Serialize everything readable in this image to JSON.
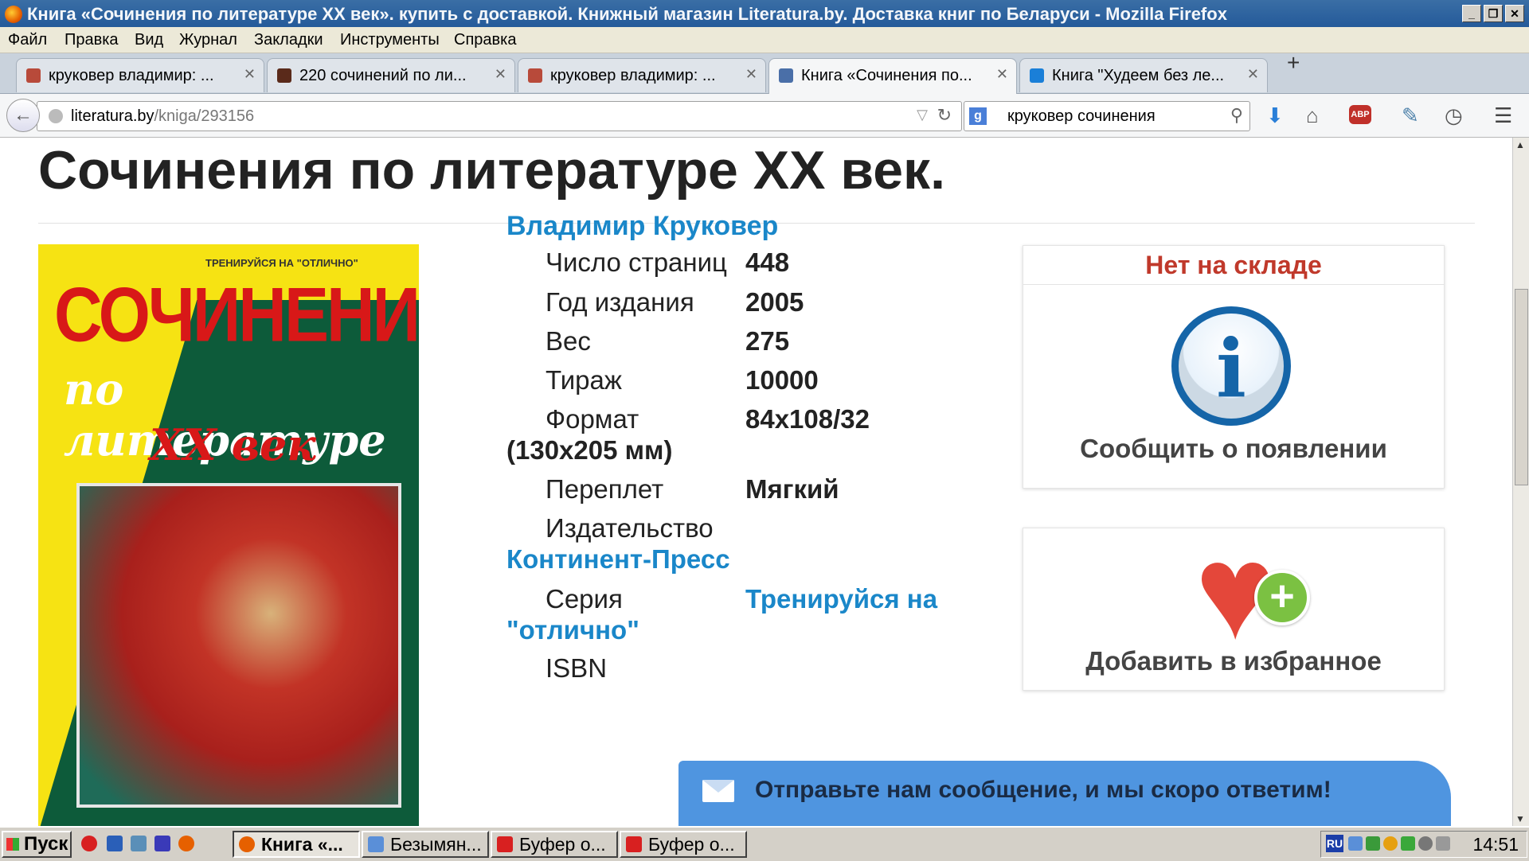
{
  "window": {
    "title": "Книга «Сочинения по литературе XX век». купить с доставкой. Книжный магазин Literatura.by. Доставка книг по Беларуси - Mozilla Firefox",
    "controls": [
      "_",
      "❐",
      "✕"
    ]
  },
  "menu": [
    "Файл",
    "Правка",
    "Вид",
    "Журнал",
    "Закладки",
    "Инструменты",
    "Справка"
  ],
  "tabs": [
    {
      "label": "круковер владимир: ...",
      "icon_color": "#b84a3a",
      "active": false
    },
    {
      "label": "220 сочинений по ли...",
      "icon_color": "#5a2a1a",
      "active": false
    },
    {
      "label": "круковер владимир: ...",
      "icon_color": "#b84a3a",
      "active": false
    },
    {
      "label": "Книга «Сочинения по...",
      "icon_color": "#4a6fa8",
      "active": true
    },
    {
      "label": "Книга \"Худеем без ле...",
      "icon_color": "#1a7fd8",
      "active": false
    }
  ],
  "tab_close": "✕",
  "new_tab": "+",
  "nav": {
    "url_host": "literatura.by",
    "url_path": "/kniga/293156",
    "search_engine_icon": "g",
    "search_value": "круковер сочинения",
    "icons": [
      "download-icon",
      "home-icon",
      "adblock-icon",
      "tools-icon",
      "history-icon",
      "menu-icon"
    ]
  },
  "page": {
    "title": "Сочинения по литературе XX век.",
    "cover": {
      "top_text": "ТРЕНИРУЙСЯ НА \"ОТЛИЧНО\"",
      "title": "СОЧИНЕНИЯ",
      "sub1": "по литературе",
      "sub2": "XX век"
    },
    "author": "Владимир Круковер",
    "props": {
      "pages_label": "Число страниц",
      "pages_value": "448",
      "year_label": "Год издания",
      "year_value": "2005",
      "weight_label": "Вес",
      "weight_value": "275",
      "run_label": "Тираж",
      "run_value": "10000",
      "format_label": "Формат",
      "format_value": "84x108/32",
      "format_extra": "(130x205 мм)",
      "binding_label": "Переплет",
      "binding_value": "Мягкий",
      "publisher_label": "Издательство",
      "publisher_value": "Континент-Пресс",
      "series_label": "Серия",
      "series_value_1": "Тренируйся на",
      "series_value_2": "\"отлично\"",
      "isbn_label": "ISBN"
    },
    "stock_status": "Нет на складе",
    "notify_label": "Сообщить о появлении",
    "favorite_label": "Добавить в избранное",
    "message_bar": "Отправьте нам сообщение, и мы скоро ответим!"
  },
  "colors": {
    "link": "#1a87c9",
    "stock": "#c0392b",
    "message_bar": "#4f95e0"
  },
  "taskbar": {
    "start": "Пуск",
    "tasks": [
      {
        "label": "Книга «...",
        "active": true,
        "icon_color": "#e66000"
      },
      {
        "label": "Безымян...",
        "active": false,
        "icon_color": "#5a8fd8"
      },
      {
        "label": "Буфер о...",
        "active": false,
        "icon_color": "#d82020"
      },
      {
        "label": "Буфер о...",
        "active": false,
        "icon_color": "#d82020"
      }
    ],
    "tray_lang": "RU",
    "clock": "14:51"
  }
}
